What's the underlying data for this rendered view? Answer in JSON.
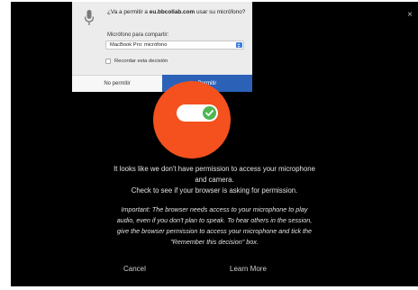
{
  "close_label": "×",
  "permission_popup": {
    "icon": "microphone-icon",
    "question_prefix": "¿Va a permitir a ",
    "site": "eu.bbcollab.com",
    "question_suffix": " usar su micrófono?",
    "share_label": "Micrófono para compartir:",
    "selected_mic": "MacBook Pro: micrófono",
    "remember_label": "Recordar esta decisión",
    "deny_label": "No permitir",
    "allow_label": "Permitir",
    "allow_color": "#2b62b8"
  },
  "hero": {
    "icon": "microphone-toggle-icon",
    "circle_color": "#f4511e",
    "knob_color": "#4fb553"
  },
  "message": {
    "line1": "It looks like we don't have permission to access your microphone",
    "line2": "and camera.",
    "line3": "Check to see if your browser is asking for permission.",
    "important_1": "Important: The browser needs access to your microphone to play",
    "important_2": "audio, even if you don't plan to speak. To hear others in the session,",
    "important_3": "give the browser permission to access your microphone and tick the",
    "important_4": "\"Remember this decision\" box."
  },
  "footer": {
    "cancel_label": "Cancel",
    "learn_more_label": "Learn More"
  }
}
